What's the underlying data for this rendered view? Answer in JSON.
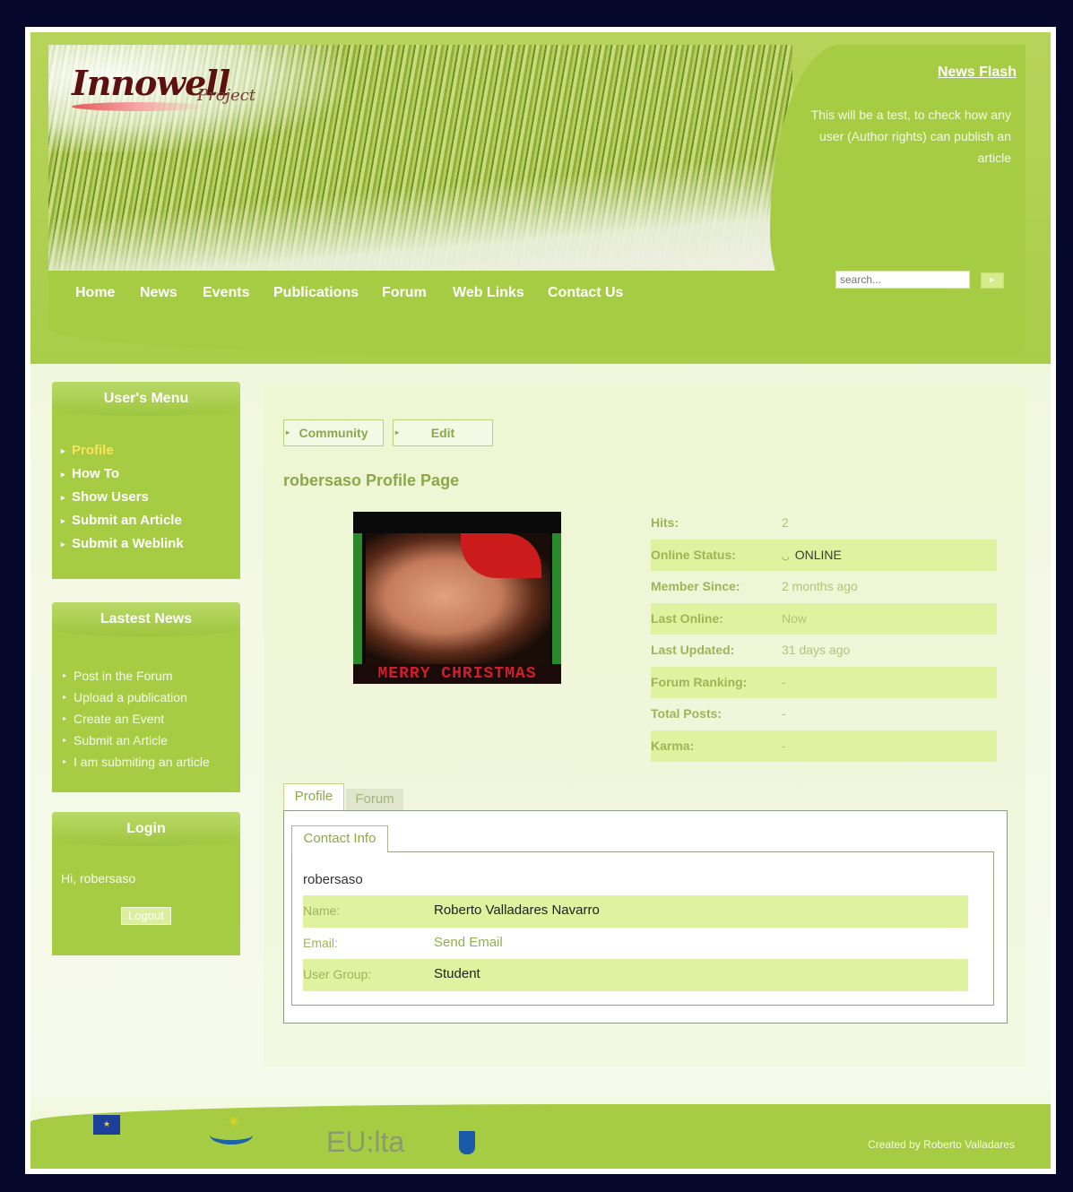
{
  "header": {
    "logo_text": "Innowell",
    "logo_sub": "Project",
    "newsflash_title": "News Flash",
    "newsflash_text": "This will be a test, to check how any user (Author rights) can publish an article",
    "search_placeholder": "search...",
    "nav": [
      "Home",
      "News",
      "Events",
      "Publications",
      "Forum",
      "Web Links",
      "Contact Us"
    ]
  },
  "sidebar": {
    "users_menu": {
      "title": "User's Menu",
      "items": [
        "Profile",
        "How To",
        "Show Users",
        "Submit an Article",
        "Submit a Weblink"
      ]
    },
    "latest_news": {
      "title": "Lastest News",
      "items": [
        "Post in the Forum",
        "Upload a publication",
        "Create an Event",
        "Submit an Article",
        "I am submiting an article"
      ]
    },
    "login": {
      "title": "Login",
      "greeting": "Hi, robersaso",
      "logout_label": "Logout"
    }
  },
  "main": {
    "tabs": [
      "Community",
      "Edit"
    ],
    "title": "robersaso Profile Page",
    "avatar_caption": "MERRY CHRISTMAS",
    "stats": [
      {
        "label": "Hits:",
        "value": "2"
      },
      {
        "label": "Online Status:",
        "value": "ONLINE"
      },
      {
        "label": "Member Since:",
        "value": "2 months ago"
      },
      {
        "label": "Last Online:",
        "value": "Now"
      },
      {
        "label": "Last Updated:",
        "value": "31 days ago"
      },
      {
        "label": "Forum Ranking:",
        "value": "-"
      },
      {
        "label": "Total Posts:",
        "value": "-"
      },
      {
        "label": "Karma:",
        "value": "-"
      }
    ],
    "panel_tabs": [
      "Profile",
      "Forum"
    ],
    "subtab": "Contact Info",
    "username": "robersaso",
    "info": [
      {
        "label": "Name:",
        "value": "Roberto Valladares Navarro"
      },
      {
        "label": "Email:",
        "value": "Send Email"
      },
      {
        "label": "User Group:",
        "value": "Student"
      }
    ]
  },
  "footer": {
    "credits": "Created by Roberto Valladares",
    "eulta": "EU:lta"
  }
}
